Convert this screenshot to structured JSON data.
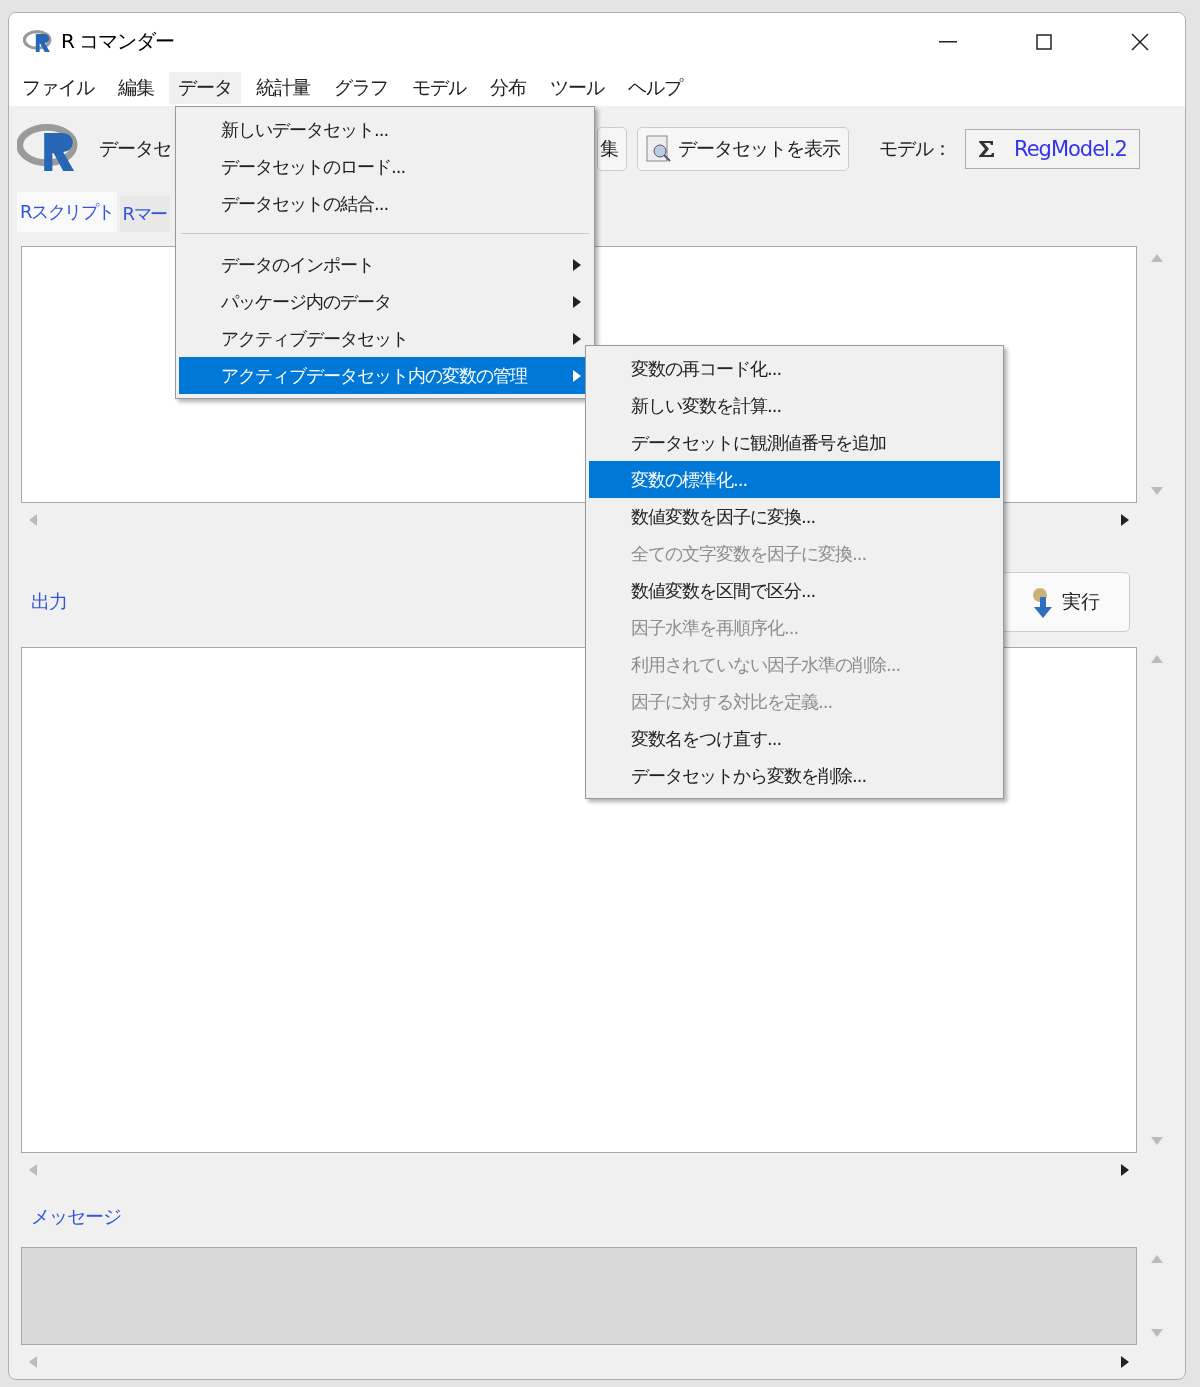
{
  "window": {
    "title": "R コマンダー"
  },
  "menubar": [
    {
      "label": "ファイル",
      "selected": false
    },
    {
      "label": "編集",
      "selected": false
    },
    {
      "label": "データ",
      "selected": true
    },
    {
      "label": "統計量",
      "selected": false
    },
    {
      "label": "グラフ",
      "selected": false
    },
    {
      "label": "モデル",
      "selected": false
    },
    {
      "label": "分布",
      "selected": false
    },
    {
      "label": "ツール",
      "selected": false
    },
    {
      "label": "ヘルプ",
      "selected": false
    }
  ],
  "toolbar": {
    "dataset_label": "データセ",
    "edit_button": "集",
    "view_button": "データセットを表示",
    "model_label": "モデル：",
    "model_value": "RegModel.2"
  },
  "tabs": [
    {
      "label": "Rスクリプト",
      "selected": true
    },
    {
      "label": "Rマー",
      "selected": false
    }
  ],
  "run_button": "実行",
  "output_label": "出力",
  "messages_label": "メッセージ",
  "data_menu": [
    {
      "kind": "item",
      "label": "新しいデータセット...",
      "selected": false
    },
    {
      "kind": "item",
      "label": "データセットのロード...",
      "selected": false
    },
    {
      "kind": "item",
      "label": "データセットの結合...",
      "selected": false
    },
    {
      "kind": "separator"
    },
    {
      "kind": "submenu",
      "label": "データのインポート",
      "selected": false
    },
    {
      "kind": "submenu",
      "label": "パッケージ内のデータ",
      "selected": false
    },
    {
      "kind": "submenu",
      "label": "アクティブデータセット",
      "selected": false
    },
    {
      "kind": "submenu",
      "label": "アクティブデータセット内の変数の管理",
      "selected": true
    }
  ],
  "variables_submenu": [
    {
      "label": "変数の再コード化...",
      "selected": false,
      "disabled": false
    },
    {
      "label": "新しい変数を計算...",
      "selected": false,
      "disabled": false
    },
    {
      "label": "データセットに観測値番号を追加",
      "selected": false,
      "disabled": false
    },
    {
      "label": "変数の標準化...",
      "selected": true,
      "disabled": false
    },
    {
      "label": "数値変数を因子に変換...",
      "selected": false,
      "disabled": false
    },
    {
      "label": "全ての文字変数を因子に変換...",
      "selected": false,
      "disabled": true
    },
    {
      "label": "数値変数を区間で区分...",
      "selected": false,
      "disabled": false
    },
    {
      "label": "因子水準を再順序化...",
      "selected": false,
      "disabled": true
    },
    {
      "label": "利用されていない因子水準の削除...",
      "selected": false,
      "disabled": true
    },
    {
      "label": "因子に対する対比を定義...",
      "selected": false,
      "disabled": true
    },
    {
      "label": "変数名をつけ直す...",
      "selected": false,
      "disabled": false
    },
    {
      "label": "データセットから変数を削除...",
      "selected": false,
      "disabled": false
    }
  ]
}
